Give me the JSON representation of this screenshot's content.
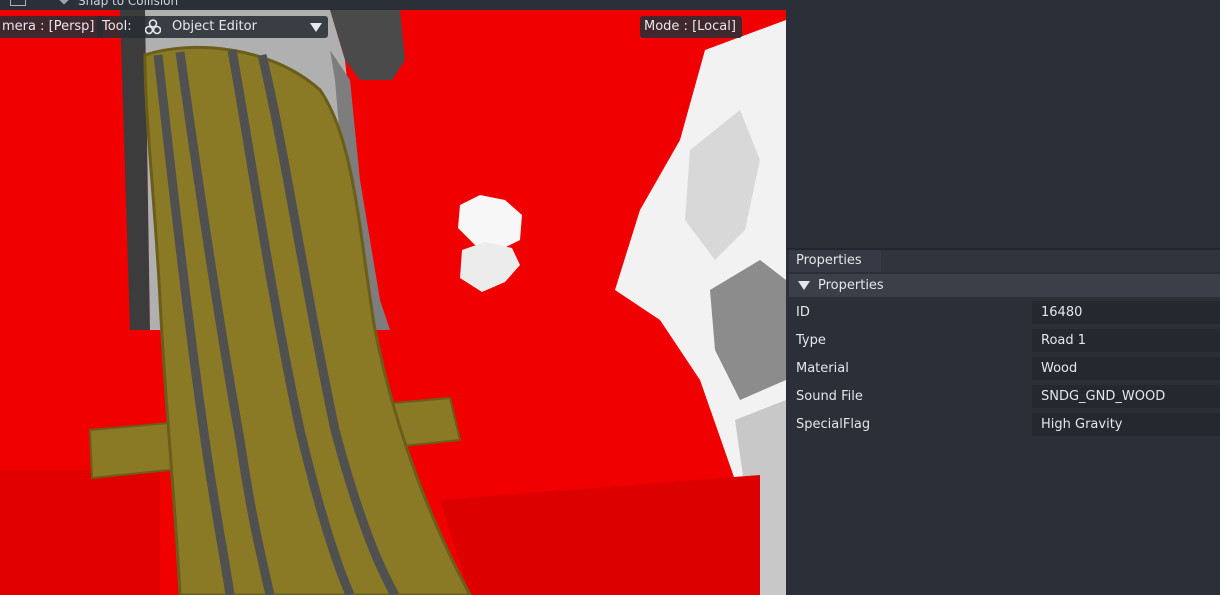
{
  "window": {
    "top_hint": "Snap to Collision"
  },
  "viewport": {
    "camera_label": "mera : [Persp]",
    "tool_label": "Tool:",
    "tool_value": "Object Editor",
    "mode_label": "Mode : [Local]"
  },
  "panel": {
    "tab_label": "Properties",
    "section_label": "Properties",
    "properties": [
      {
        "name": "ID",
        "value": "16480"
      },
      {
        "name": "Type",
        "value": "Road 1"
      },
      {
        "name": "Material",
        "value": "Wood"
      },
      {
        "name": "Sound File",
        "value": "SNDG_GND_WOOD"
      },
      {
        "name": "SpecialFlag",
        "value": "High Gravity"
      }
    ]
  },
  "icons": {
    "tool": "objects-icon",
    "dropdown": "chevron-down-icon",
    "collapse": "triangle-down-icon"
  },
  "colors": {
    "collision_red": "#f00000",
    "road_wood": "#8a7a26",
    "panel_bg": "#2b2f37"
  }
}
